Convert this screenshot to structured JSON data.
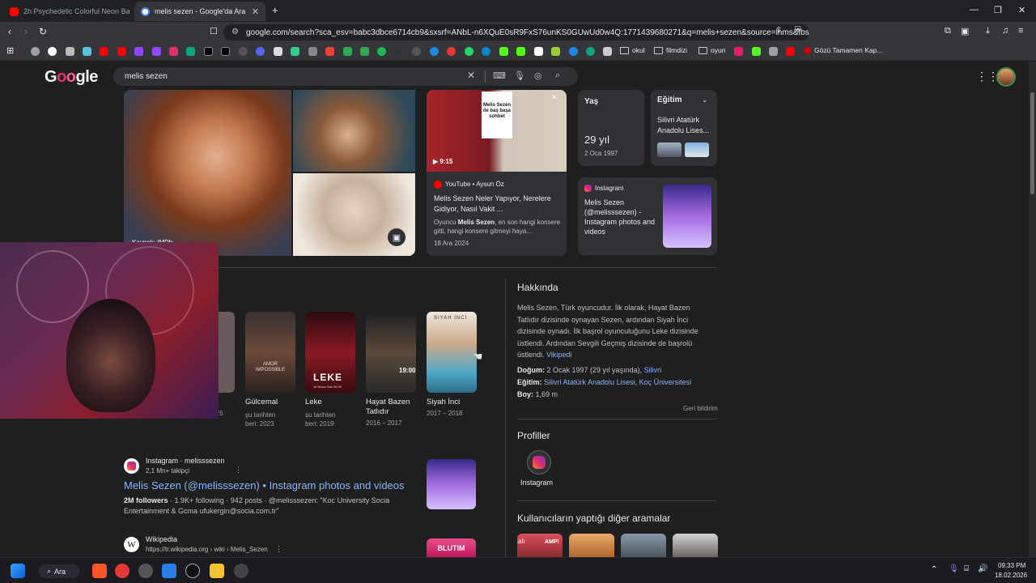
{
  "tabs": [
    {
      "label": "2h Psychedelic Colorful Neon Backg",
      "active": false
    },
    {
      "label": "melis sezen - Google'da Ara",
      "active": true
    }
  ],
  "new_tab_symbol": "+",
  "window_controls": {
    "minimize": "—",
    "restore": "❐",
    "close": "✕"
  },
  "address_bar": {
    "url": "google.com/search?sca_esv=babc3dbce6714cb9&sxsrf=ANbL-n6XQuE0sR9FxS76unKS0GUwUd0w4Q:1771439680271&q=melis+sezen&source=lnms&fbs..."
  },
  "bookmarks": {
    "folders": [
      "okul",
      "filmdizi",
      "oyun"
    ],
    "last": "Gözü Tamamen Kap..."
  },
  "google": {
    "logo": "Google",
    "search_query": "melis sezen"
  },
  "media_panel": {
    "main_image_caption": "Kaynak: IMDb",
    "video": {
      "duration": "▶ 9:15",
      "thumb_text": "Melis Sezen ile baş başa sohbet",
      "source": "YouTube • Aysun Öz",
      "title": "Melis Sezen Neler Yapıyor, Nerelere Gidiyor, Nasıl Vakit ...",
      "snippet_pre": "Oyuncu ",
      "snippet_bold": "Melis Sezen",
      "snippet_post": ", en son hangi konsere gitti, hangi konsere gitmeyi haya...",
      "date": "18 Ara 2024"
    },
    "age_card": {
      "label": "Yaş",
      "value": "29 yıl",
      "sub": "2 Oca 1997"
    },
    "edu_card": {
      "label": "Eğitim",
      "value": "Silivri Atatürk Anadolu Lises..."
    },
    "instagram_card": {
      "source": "Instagram",
      "title": "Melis Sezen (@melisssezen) - Instagram photos and videos"
    }
  },
  "shows": [
    {
      "title": "Gülcemal",
      "sub1": "şu tarihten",
      "sub2": "beri: 2023"
    },
    {
      "title": "Leke",
      "sub1": "şu tarihten",
      "sub2": "beri: 2019"
    },
    {
      "title": "Hayat Bazen Tatlıdır",
      "sub1": "2016 – 2017",
      "sub2": ""
    },
    {
      "title": "Siyah İnci",
      "sub1": "2017 – 2018",
      "sub2": ""
    }
  ],
  "show_partial_year": "2025",
  "poster_texts": {
    "amor": "AMOR IMPOSSIBLE",
    "leke": "LEKE",
    "leke_sub": "16 Nisan Salı 20.00",
    "hb_time": "19:00",
    "siyah": "SIYAH İNCİ"
  },
  "results": [
    {
      "site": "Instagram · melisssezen",
      "followers": "2,1 Mn+ takipçi",
      "title": "Melis Sezen (@melisssezen) • Instagram photos and videos",
      "snippet_bold": "2M followers",
      "snippet": " · 1.9K+ following · 942 posts · @melisssezen: \"Koc University Socia Entertainment & Gcma ufukergin@socia.com.tr\""
    },
    {
      "site": "Wikipedia",
      "url": "https://tr.wikipedia.org › wiki › Melis_Sezen",
      "thumb_text": "BLUTIM"
    }
  ],
  "knowledge": {
    "about_title": "Hakkında",
    "about_text": "Melis Sezen, Türk oyuncudur. İlk olarak, Hayat Bazen Tatlıdır dizisinde oynayan Sezen, ardından Siyah İnci dizisinde oynadı. İlk başrol oyunculuğunu Leke dizisinde üstlendi. Ardından Sevgili Geçmiş dizisinde de başrolü üstlendi.",
    "about_link": "Vikipedi",
    "birth_label": "Doğum:",
    "birth_value": "2 Ocak 1997 (29 yıl yaşında),",
    "birth_link": "Silivri",
    "edu_label": "Eğitim:",
    "edu_link1": "Silivri Atatürk Anadolu Lisesi",
    "edu_sep": ",",
    "edu_link2": "Koç Üniversitesi",
    "height_label": "Boy:",
    "height_value": "1,69 m",
    "feedback": "Geri bildirim",
    "profiles_title": "Profiller",
    "profile_instagram": "Instagram",
    "related_title": "Kullanıcıların yaptığı diğer aramalar",
    "related_thumb_text": "alı",
    "related_thumb_text2": "AMPI"
  },
  "taskbar": {
    "search_label": "Ara",
    "time": "09:33 PM",
    "date": "18.02.2026"
  },
  "colors": {
    "accent_link": "#8ab4f8",
    "page_bg": "#1f1f1f",
    "card_bg": "#303134"
  }
}
